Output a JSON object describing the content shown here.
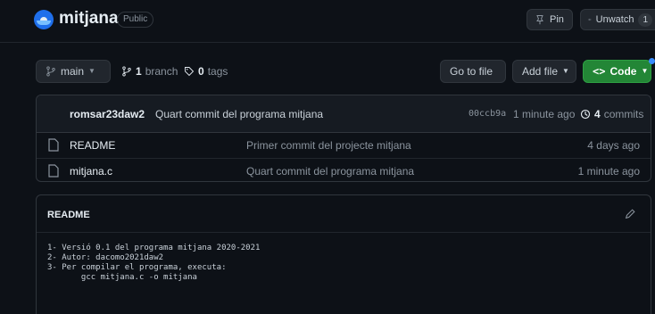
{
  "repo": {
    "name": "mitjana",
    "visibility": "Public",
    "pin_label": "Pin",
    "watch_label": "Unwatch",
    "watch_count": "1"
  },
  "toolbar": {
    "branch_label": "main",
    "branch_count": "1",
    "branch_word": "branch",
    "tags_count": "0",
    "tags_word": "tags",
    "goto_label": "Go to file",
    "addfile_label": "Add file",
    "code_label": "Code"
  },
  "commit": {
    "author": "romsar23daw2",
    "message": "Quart commit del programa mitjana",
    "sha": "00ccb9a",
    "time": "1 minute ago",
    "count": "4",
    "count_word": "commits"
  },
  "files": [
    {
      "name": "README",
      "commit": "Primer commit del projecte mitjana",
      "age": "4 days ago"
    },
    {
      "name": "mitjana.c",
      "commit": "Quart commit del programa mitjana",
      "age": "1 minute ago"
    }
  ],
  "readme": {
    "title": "README",
    "lines": [
      "1- Versió 0.1 del programa mitjana 2020-2021",
      "2- Autor: dacomo2021daw2",
      "3- Per compilar el programa, executa:",
      "       gcc mitjana.c -o mitjana"
    ]
  },
  "colors": {
    "background": "#0d1117",
    "accent_green": "#238636",
    "border": "#30363d"
  }
}
